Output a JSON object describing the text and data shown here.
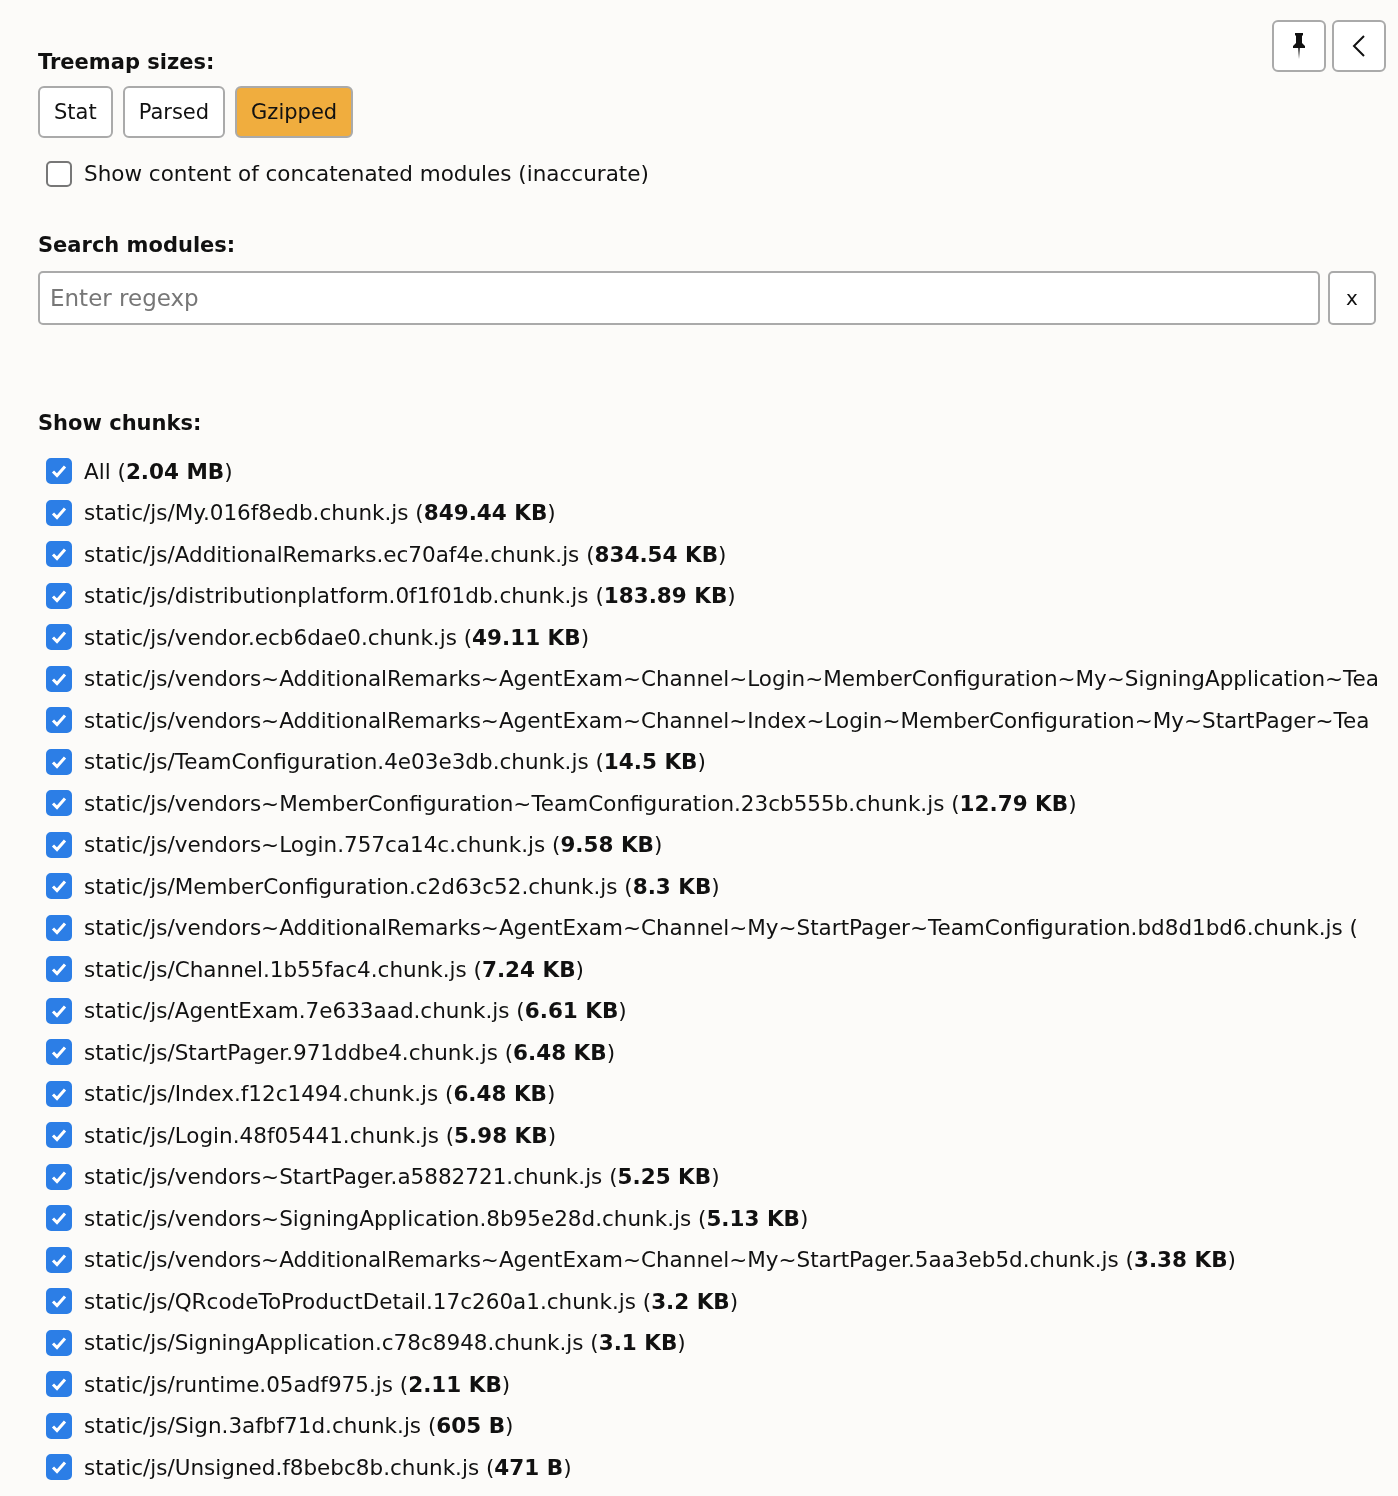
{
  "toolbar": {
    "pin_button": {
      "pinned": false
    }
  },
  "treemap_sizes": {
    "title": "Treemap sizes:",
    "options": [
      {
        "label": "Stat",
        "selected": false
      },
      {
        "label": "Parsed",
        "selected": false
      },
      {
        "label": "Gzipped",
        "selected": true
      }
    ]
  },
  "concatenated": {
    "label": "Show content of concatenated modules (inaccurate)",
    "checked": false
  },
  "search": {
    "title": "Search modules:",
    "placeholder": "Enter regexp",
    "clear_label": "x"
  },
  "chunks": {
    "title": "Show chunks:",
    "items": [
      {
        "label": "All (**2.04 MB**)",
        "checked": true
      },
      {
        "label": "static/js/My.016f8edb.chunk.js (**849.44 KB**)",
        "checked": true
      },
      {
        "label": "static/js/AdditionalRemarks.ec70af4e.chunk.js (**834.54 KB**)",
        "checked": true
      },
      {
        "label": "static/js/distributionplatform.0f1f01db.chunk.js (**183.89 KB**)",
        "checked": true
      },
      {
        "label": "static/js/vendor.ecb6dae0.chunk.js (**49.11 KB**)",
        "checked": true
      },
      {
        "label": "static/js/vendors~AdditionalRemarks~AgentExam~Channel~Login~MemberConfiguration~My~SigningApplication~Tea",
        "checked": true
      },
      {
        "label": "static/js/vendors~AdditionalRemarks~AgentExam~Channel~Index~Login~MemberConfiguration~My~StartPager~Tea",
        "checked": true
      },
      {
        "label": "static/js/TeamConfiguration.4e03e3db.chunk.js (**14.5 KB**)",
        "checked": true
      },
      {
        "label": "static/js/vendors~MemberConfiguration~TeamConfiguration.23cb555b.chunk.js (**12.79 KB**)",
        "checked": true
      },
      {
        "label": "static/js/vendors~Login.757ca14c.chunk.js (**9.58 KB**)",
        "checked": true
      },
      {
        "label": "static/js/MemberConfiguration.c2d63c52.chunk.js (**8.3 KB**)",
        "checked": true
      },
      {
        "label": "static/js/vendors~AdditionalRemarks~AgentExam~Channel~My~StartPager~TeamConfiguration.bd8d1bd6.chunk.js (",
        "checked": true
      },
      {
        "label": "static/js/Channel.1b55fac4.chunk.js (**7.24 KB**)",
        "checked": true
      },
      {
        "label": "static/js/AgentExam.7e633aad.chunk.js (**6.61 KB**)",
        "checked": true
      },
      {
        "label": "static/js/StartPager.971ddbe4.chunk.js (**6.48 KB**)",
        "checked": true
      },
      {
        "label": "static/js/Index.f12c1494.chunk.js (**6.48 KB**)",
        "checked": true
      },
      {
        "label": "static/js/Login.48f05441.chunk.js (**5.98 KB**)",
        "checked": true
      },
      {
        "label": "static/js/vendors~StartPager.a5882721.chunk.js (**5.25 KB**)",
        "checked": true
      },
      {
        "label": "static/js/vendors~SigningApplication.8b95e28d.chunk.js (**5.13 KB**)",
        "checked": true
      },
      {
        "label": "static/js/vendors~AdditionalRemarks~AgentExam~Channel~My~StartPager.5aa3eb5d.chunk.js (**3.38 KB**)",
        "checked": true
      },
      {
        "label": "static/js/QRcodeToProductDetail.17c260a1.chunk.js (**3.2 KB**)",
        "checked": true
      },
      {
        "label": "static/js/SigningApplication.c78c8948.chunk.js (**3.1 KB**)",
        "checked": true
      },
      {
        "label": "static/js/runtime.05adf975.js (**2.11 KB**)",
        "checked": true
      },
      {
        "label": "static/js/Sign.3afbf71d.chunk.js (**605 B**)",
        "checked": true
      },
      {
        "label": "static/js/Unsigned.f8bebc8b.chunk.js (**471 B**)",
        "checked": true
      }
    ]
  }
}
